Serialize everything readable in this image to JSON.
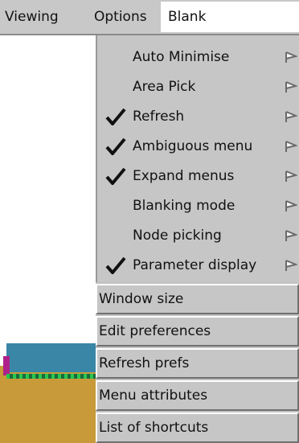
{
  "menubar": {
    "viewing": "Viewing",
    "options": "Options",
    "blank": "Blank"
  },
  "dropdown": {
    "toggle_items": [
      {
        "label": "Auto Minimise",
        "checked": false
      },
      {
        "label": "Area Pick",
        "checked": false
      },
      {
        "label": "Refresh",
        "checked": true
      },
      {
        "label": "Ambiguous menu",
        "checked": true
      },
      {
        "label": "Expand menus",
        "checked": true
      },
      {
        "label": "Blanking mode",
        "checked": false
      },
      {
        "label": "Node picking",
        "checked": false
      },
      {
        "label": "Parameter display",
        "checked": true
      }
    ],
    "button_items": [
      {
        "label": "Window size"
      },
      {
        "label": "Edit preferences"
      },
      {
        "label": "Refresh prefs"
      },
      {
        "label": "Menu attributes"
      },
      {
        "label": "List of shortcuts"
      }
    ],
    "submenu_icon": "triangle-flag-icon",
    "check_icon": "checkmark-icon"
  }
}
